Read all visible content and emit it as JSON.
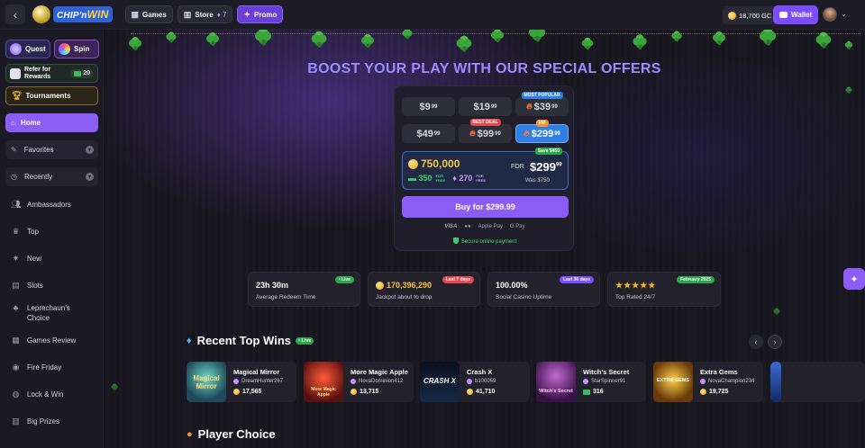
{
  "header": {
    "logo_text_a": "CHIP'n",
    "logo_text_b": "WIN",
    "nav": [
      {
        "label": "Games",
        "icon": "grid-icon"
      },
      {
        "label": "Store",
        "icon": "store-icon",
        "count": "7"
      },
      {
        "label": "Promo",
        "icon": "gift-icon"
      }
    ],
    "gc_balance": "18,700 GC",
    "wallet_label": "Wallet"
  },
  "sidebar": {
    "quest": "Quest",
    "spin": "Spin",
    "refer_line1": "Refer for",
    "refer_line2": "Rewards",
    "refer_badge": "20",
    "tournaments": "Tournaments",
    "home": "Home",
    "favorites": "Favorites",
    "recently": "Recently",
    "items": [
      {
        "label": "Ambassadors",
        "icon": "people-icon"
      },
      {
        "label": "Top",
        "icon": "crown-icon"
      },
      {
        "label": "New",
        "icon": "sparkle-icon"
      },
      {
        "label": "Slots",
        "icon": "slots-icon"
      },
      {
        "label": "Leprechaun's Choice",
        "label_a": "Leprechaun's",
        "label_b": "Choice",
        "icon": "clover-icon"
      },
      {
        "label": "Games Review",
        "icon": "review-icon"
      },
      {
        "label": "Fire Friday",
        "icon": "fire-icon"
      },
      {
        "label": "Lock & Win",
        "icon": "lock-icon"
      },
      {
        "label": "Big Prizes",
        "icon": "trophy-icon"
      }
    ]
  },
  "offers": {
    "headline": "BOOST YOUR PLAY WITH OUR SPECIAL OFFERS",
    "tiles": [
      {
        "main": "$9",
        "cents": "99"
      },
      {
        "main": "$19",
        "cents": "99"
      },
      {
        "main": "$39",
        "cents": "99",
        "badge": "MOST POPULAR"
      },
      {
        "main": "$49",
        "cents": "99"
      },
      {
        "main": "$99",
        "cents": "99",
        "badge": "BEST DEAL"
      },
      {
        "main": "$299",
        "cents": "99",
        "badge": "VIP"
      }
    ],
    "save_badge": "Save $450",
    "gc_amount": "750,000",
    "sc_amount": "350",
    "sc_note_a": "FOR",
    "sc_note_b": "FREE",
    "gems_amount": "270",
    "gems_note_a": "FOR",
    "gems_note_b": "FREE",
    "for_label": "FOR",
    "for_price_main": "$299",
    "for_price_cents": "99",
    "was": "Was $750",
    "buy_label": "Buy for $299.99",
    "pay_methods": [
      "VISA",
      "●●",
      "Apple Pay",
      "G Pay"
    ],
    "secure": "Secure online payment"
  },
  "stats": [
    {
      "value": "23h 30m",
      "label": "Average Redeem Time",
      "tag": "• Live",
      "tag_color": "#2aa84a"
    },
    {
      "value": "170,396,290",
      "label": "Jackpot about to drop",
      "tag": "Last 7 days",
      "tag_color": "#e5484d"
    },
    {
      "value": "100.00%",
      "label": "Social Casino Uptime",
      "tag": "Last 30 days",
      "tag_color": "#7c4dff"
    },
    {
      "value": "★★★★★",
      "label": "Top Rated 24/7",
      "tag": "February 2025",
      "tag_color": "#2aa84a",
      "rating": 5
    }
  ],
  "recent_wins": {
    "title": "Recent Top Wins",
    "live": "• Live",
    "items": [
      {
        "game": "Magical Mirror",
        "thumb_text": "Magical Mirror",
        "user": "DreamHunter267",
        "amount": "17,565",
        "currency": "gc"
      },
      {
        "game": "More Magic Apple",
        "thumb_text": "More Magic Apple",
        "user": "NovaDominion412",
        "amount": "13,715",
        "currency": "gc"
      },
      {
        "game": "Crash X",
        "thumb_text": "CRASH X",
        "user": "b100059",
        "amount": "41,710",
        "currency": "gc"
      },
      {
        "game": "Witch's Secret",
        "thumb_text": "Witch's Secret",
        "user": "StarSpinner91",
        "amount": "316",
        "currency": "sc"
      },
      {
        "game": "Extra Gems",
        "thumb_text": "EXTRA GEMS",
        "user": "NovaChampion234",
        "amount": "19,725",
        "currency": "gc"
      }
    ]
  },
  "player_choice": {
    "title": "Player Choice"
  },
  "colors": {
    "accent": "#8b5cf6",
    "green": "#2aa84a",
    "gold": "#f7c543",
    "blue": "#2f7fe6"
  }
}
